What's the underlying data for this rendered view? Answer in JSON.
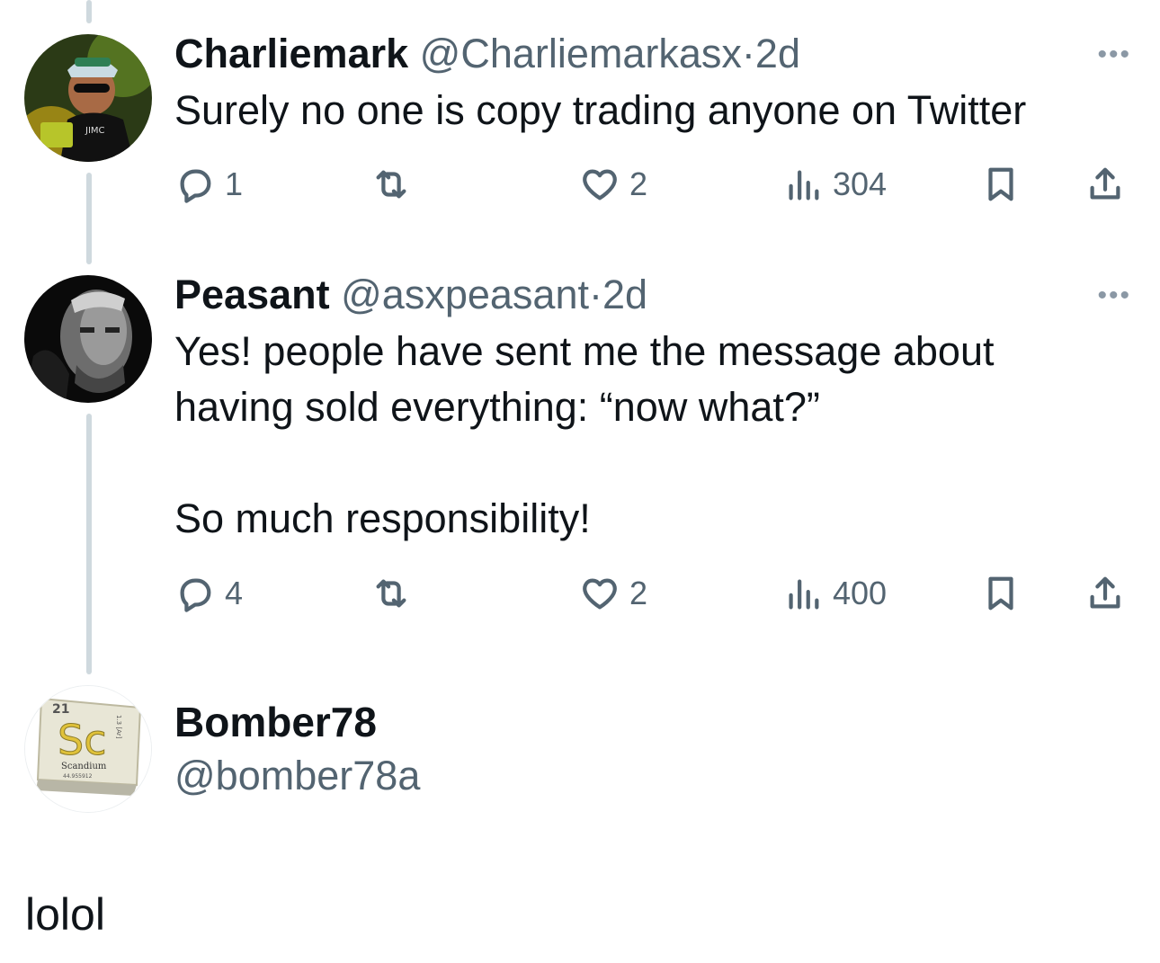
{
  "tweets": [
    {
      "name": "Charliemark",
      "handle": "@Charliemarkasx",
      "dot": "·",
      "time": "2d",
      "text": "Surely no one is copy trading anyone on Twitter",
      "replies": "1",
      "likes": "2",
      "views": "304",
      "more": "•••"
    },
    {
      "name": "Peasant",
      "handle": "@asxpeasant",
      "dot": "·",
      "time": "2d",
      "text_line1": "Yes! people have sent me the message about",
      "text_line2": "having sold everything: “now what?”",
      "text_line3": "So much responsibility!",
      "replies": "4",
      "likes": "2",
      "views": "400",
      "more": "•••"
    }
  ],
  "reply_author": {
    "name": "Bomber78",
    "handle": "@bomber78a",
    "avatar_element": {
      "number": "21",
      "symbol": "Sc",
      "element_name": "Scandium",
      "mass": "44.955912",
      "side_text": "1.3 [Ar]"
    }
  },
  "reply_text": "lolol",
  "icons": [
    "reply-icon",
    "retweet-icon",
    "like-icon",
    "views-icon",
    "bookmark-icon",
    "share-icon",
    "more-icon"
  ],
  "colors": {
    "text": "#0f1419",
    "secondary": "#536471",
    "thread_line": "#cfd9de"
  }
}
